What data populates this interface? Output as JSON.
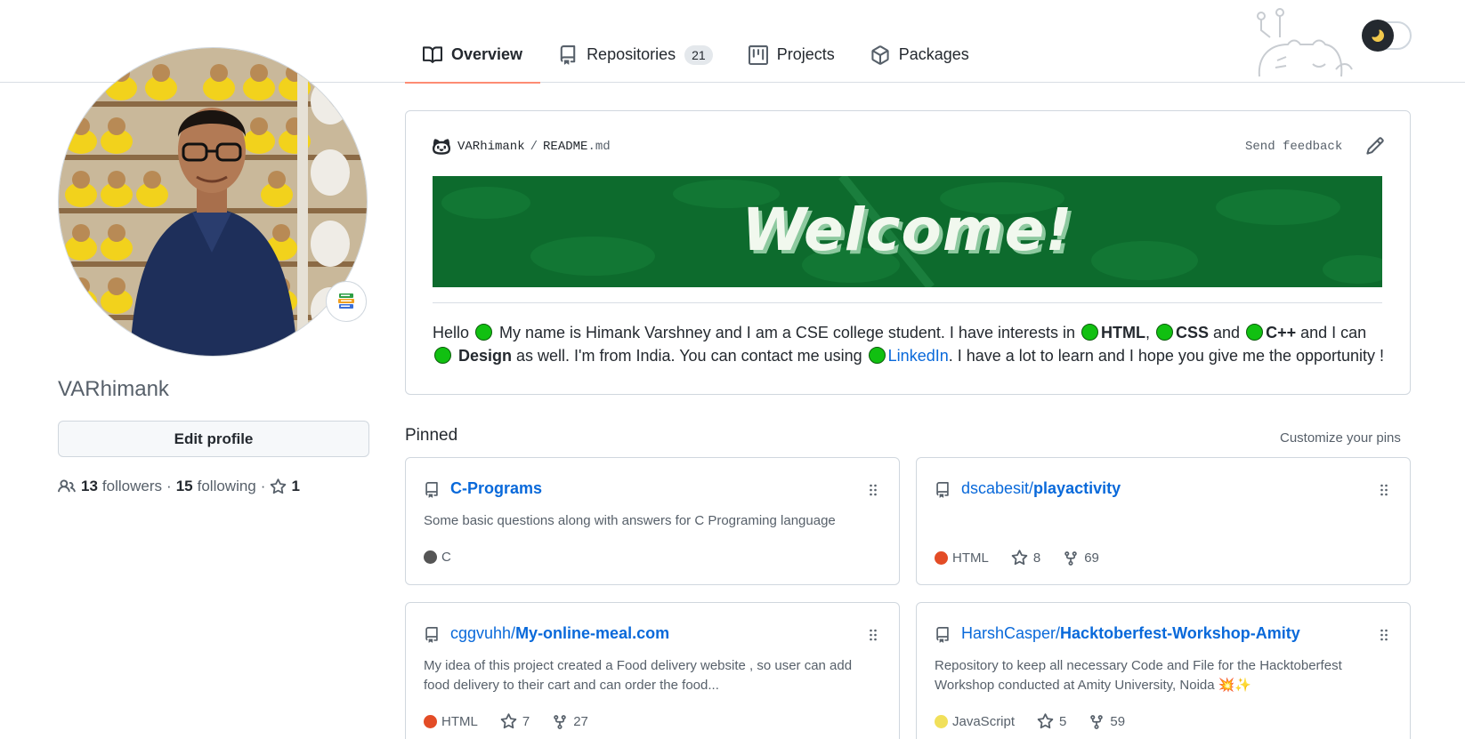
{
  "tabs": [
    {
      "label": "Overview",
      "icon": "book-icon",
      "active": true
    },
    {
      "label": "Repositories",
      "icon": "repo-icon",
      "count": "21"
    },
    {
      "label": "Projects",
      "icon": "project-icon"
    },
    {
      "label": "Packages",
      "icon": "package-icon"
    }
  ],
  "theme_toggle": {
    "icon": "moon-icon"
  },
  "profile": {
    "username": "VARhimank",
    "edit_label": "Edit profile",
    "followers_count": "13",
    "followers_label": "followers",
    "following_count": "15",
    "following_label": "following",
    "stars_count": "1",
    "separator": "·"
  },
  "readme": {
    "owner": "VARhimank",
    "slash": "/",
    "file_name": "README",
    "file_ext": ".md",
    "feedback": "Send feedback",
    "banner_text": "Welcome!",
    "body": {
      "p1": "Hello ",
      "p2": " My name is Himank Varshney and I am a CSE college student. I have interests in ",
      "html": "HTML",
      "comma": ", ",
      "css": "CSS",
      "and1": " and ",
      "cpp": "C++",
      "and2": " and I can ",
      "design": "Design",
      "p3": " as well. I'm from India. You can contact me using ",
      "linkedin": "LinkedIn",
      "p4": ". I have a lot to learn and I hope you give me the opportunity !"
    }
  },
  "pinned": {
    "title": "Pinned",
    "customize": "Customize your pins",
    "repos": [
      {
        "owner": "",
        "name": "C-Programs",
        "description": "Some basic questions along with answers for C Programing language",
        "language": "C",
        "language_color": "#555555",
        "stars": "",
        "forks": ""
      },
      {
        "owner": "dscabesit/",
        "name": "playactivity",
        "description": "",
        "language": "HTML",
        "language_color": "#e34c26",
        "stars": "8",
        "forks": "69"
      },
      {
        "owner": "cggvuhh/",
        "name": "My-online-meal.com",
        "description": "My idea of this project created a Food delivery website , so user can add food delivery to their cart and can order the food...",
        "language": "HTML",
        "language_color": "#e34c26",
        "stars": "7",
        "forks": "27"
      },
      {
        "owner": "HarshCasper/",
        "name": "Hacktoberfest-Workshop-Amity",
        "description": "Repository to keep all necessary Code and File for the Hacktoberfest Workshop conducted at Amity University, Noida 💥✨",
        "language": "JavaScript",
        "language_color": "#f1e05a",
        "stars": "5",
        "forks": "59"
      }
    ]
  }
}
